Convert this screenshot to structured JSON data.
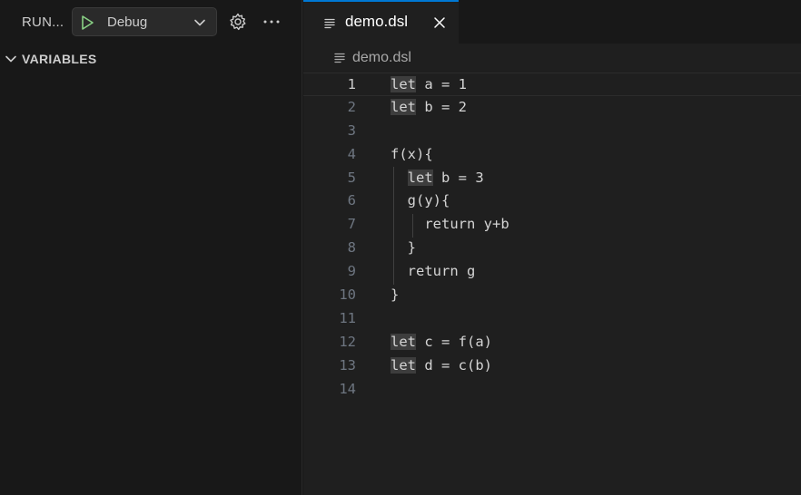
{
  "sidebar": {
    "title": "RUN...",
    "config": {
      "selected": "Debug"
    },
    "section": {
      "title": "VARIABLES"
    }
  },
  "editor": {
    "tab": {
      "label": "demo.dsl"
    },
    "breadcrumb": {
      "label": "demo.dsl"
    },
    "lines": [
      {
        "num": "1",
        "indent": "",
        "kw": "let",
        "rest": " a = 1"
      },
      {
        "num": "2",
        "indent": "",
        "kw": "let",
        "rest": " b = 2"
      },
      {
        "num": "3",
        "indent": "",
        "kw": "",
        "rest": ""
      },
      {
        "num": "4",
        "indent": "",
        "kw": "",
        "rest": "f(x){"
      },
      {
        "num": "5",
        "indent": "  ",
        "kw": "let",
        "rest": " b = 3"
      },
      {
        "num": "6",
        "indent": "  ",
        "kw": "",
        "rest": "g(y){"
      },
      {
        "num": "7",
        "indent": "    ",
        "kw": "",
        "rest": "return y+b"
      },
      {
        "num": "8",
        "indent": "  ",
        "kw": "",
        "rest": "}"
      },
      {
        "num": "9",
        "indent": "  ",
        "kw": "",
        "rest": "return g"
      },
      {
        "num": "10",
        "indent": "",
        "kw": "",
        "rest": "}"
      },
      {
        "num": "11",
        "indent": "",
        "kw": "",
        "rest": ""
      },
      {
        "num": "12",
        "indent": "",
        "kw": "let",
        "rest": " c = f(a)"
      },
      {
        "num": "13",
        "indent": "",
        "kw": "let",
        "rest": " d = c(b)"
      },
      {
        "num": "14",
        "indent": "",
        "kw": "",
        "rest": ""
      }
    ]
  },
  "icons": {
    "play": "play-icon",
    "chevron": "chevron-down-icon",
    "gear": "gear-icon",
    "more": "ellipsis-icon",
    "file": "file-lines-icon",
    "close": "close-icon"
  },
  "colors": {
    "accent": "#0078d4",
    "play": "#89d185"
  }
}
